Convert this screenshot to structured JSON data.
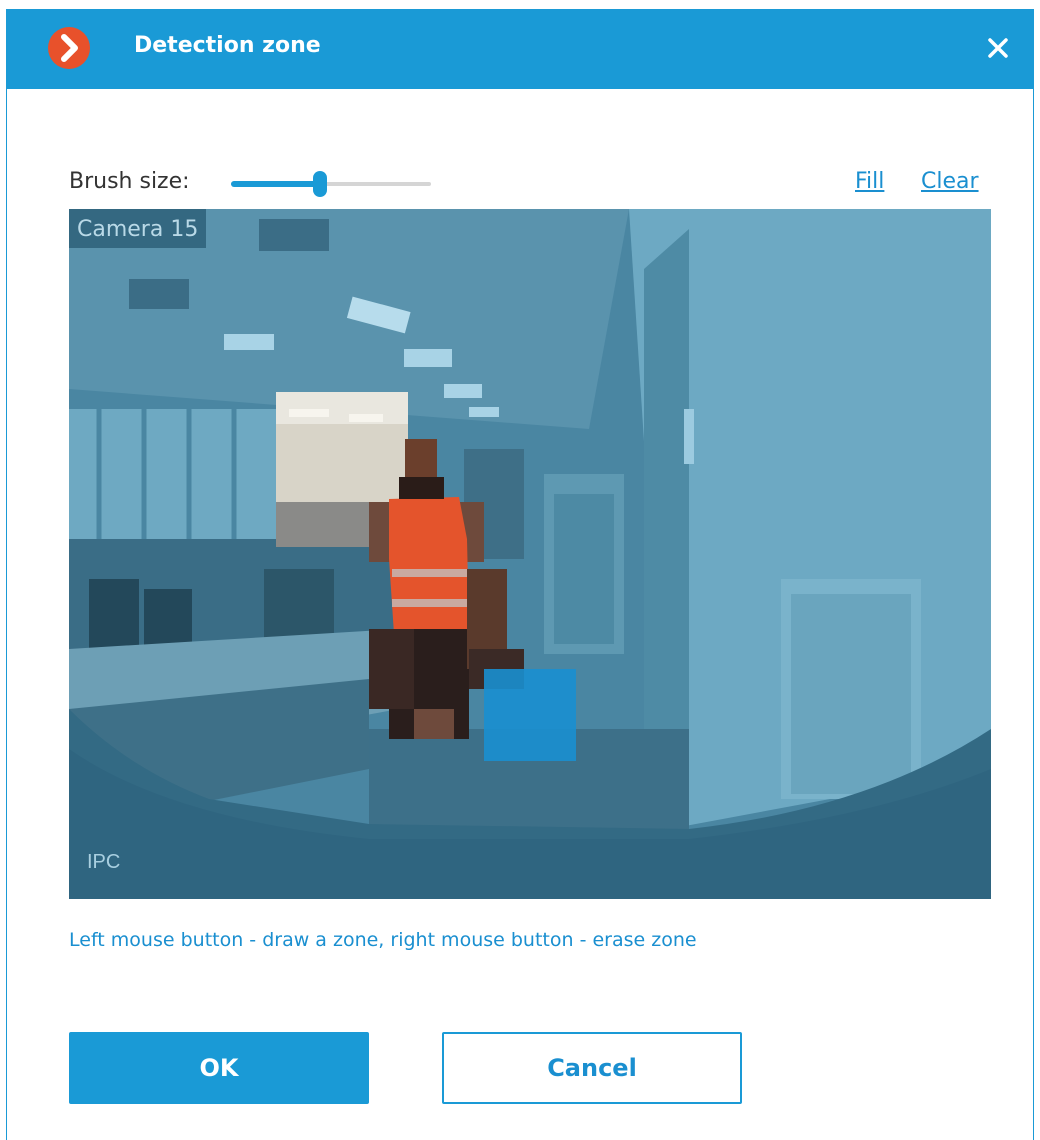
{
  "window": {
    "title": "Detection zone",
    "accent_color": "#1a9ad6",
    "app_icon": "chevron-right-icon",
    "close_icon": "close-icon"
  },
  "toolbar": {
    "brush_size_label": "Brush size:",
    "brush_size_value": 0.44,
    "fill_label": "Fill",
    "clear_label": "Clear"
  },
  "video": {
    "camera_label": "Camera 15",
    "overlay_label": "IPC"
  },
  "hint": "Left mouse button - draw a zone, right mouse button - erase zone",
  "buttons": {
    "ok_label": "OK",
    "cancel_label": "Cancel"
  }
}
